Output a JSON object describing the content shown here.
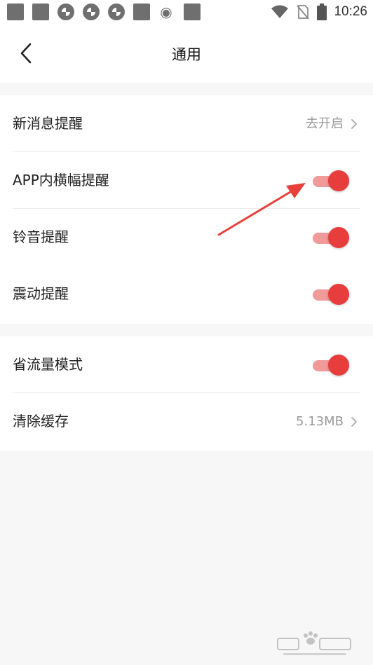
{
  "status_bar": {
    "time": "10:26"
  },
  "header": {
    "title": "通用"
  },
  "sections": [
    {
      "rows": [
        {
          "label": "新消息提醒",
          "value": "去开启"
        },
        {
          "label": "APP内横幅提醒",
          "toggle": true
        },
        {
          "label": "铃音提醒",
          "toggle": true
        },
        {
          "label": "震动提醒",
          "toggle": true
        }
      ]
    },
    {
      "rows": [
        {
          "label": "省流量模式",
          "toggle": true
        },
        {
          "label": "清除缓存",
          "value": "5.13MB"
        }
      ]
    }
  ],
  "colors": {
    "accent": "#e83d3d",
    "track": "#f19a9a",
    "background": "#f7f7f7"
  }
}
